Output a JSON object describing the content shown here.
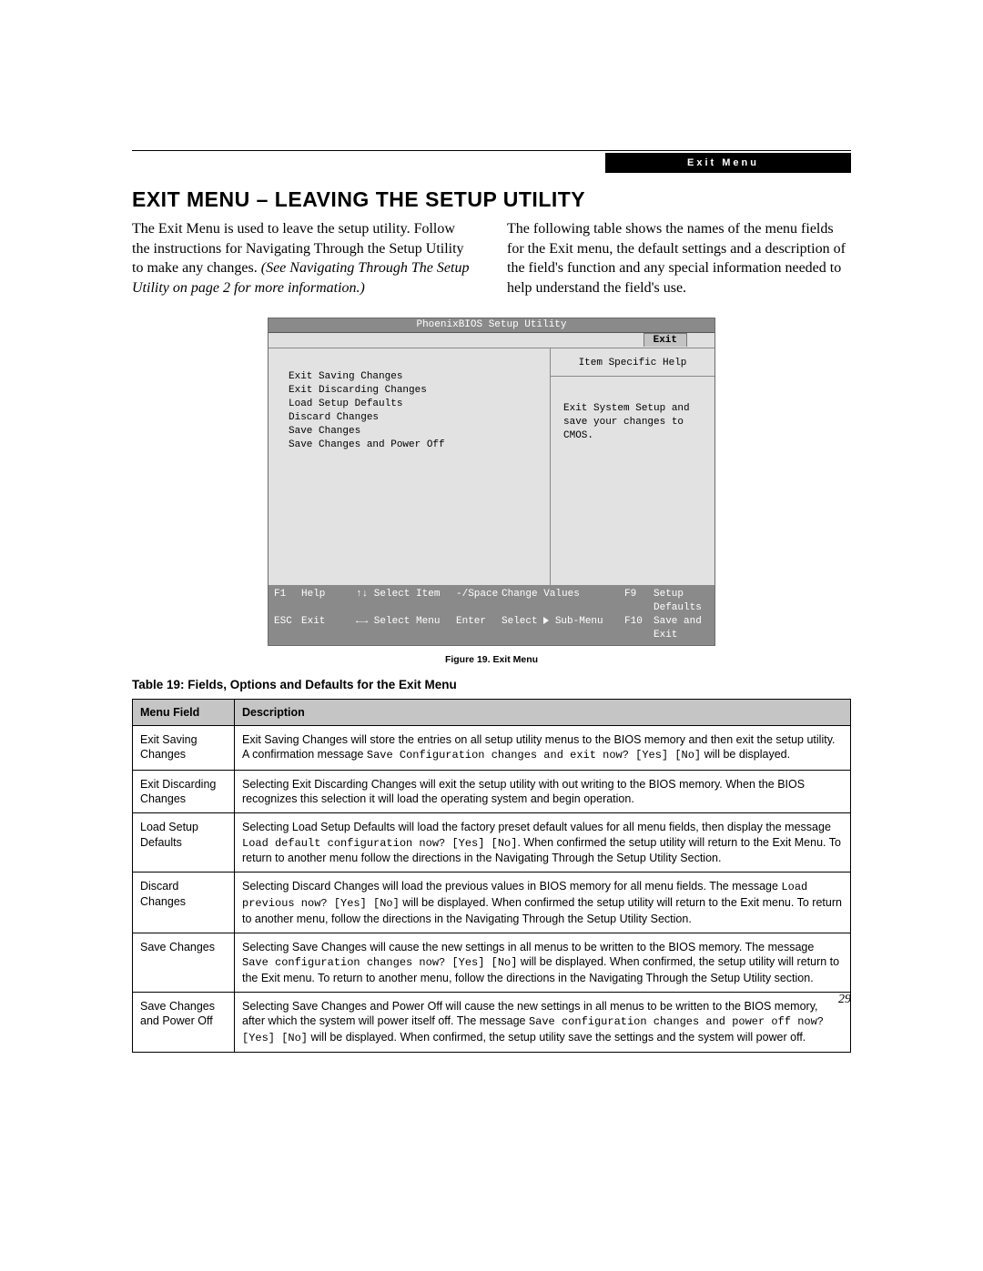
{
  "headerBadge": "Exit Menu",
  "pageTitle": "EXIT MENU – LEAVING THE SETUP UTILITY",
  "introLeft": {
    "span1": "The Exit Menu is used to leave the setup utility. Follow the instructions for Navigating Through the Setup Utility to make any changes. ",
    "italic": "(See Navigating Through The Setup Utility on page 2 for more information.)"
  },
  "introRight": "The following table shows the names of the menu fields for the Exit menu, the default settings and a description of the field's function and any special information needed to help understand the field's use.",
  "bios": {
    "title": "PhoenixBIOS Setup Utility",
    "tab": "Exit",
    "menuItems": [
      "Exit Saving Changes",
      "Exit Discarding Changes",
      "Load Setup Defaults",
      "Discard Changes",
      "Save Changes",
      "Save Changes and Power Off"
    ],
    "helpHeader": "Item Specific Help",
    "helpBody": "Exit System Setup and save your changes to CMOS.",
    "footer": {
      "row1": {
        "k1": "F1",
        "l1": "Help",
        "k2": "↑↓ Select Item",
        "k3": "-/Space",
        "l3": "Change Values",
        "k4": "F9",
        "l4": "Setup Defaults"
      },
      "row2": {
        "k1": "ESC",
        "l1": "Exit",
        "k2": "←→ Select Menu",
        "k3": "Enter",
        "l3": "Select ▶ Sub-Menu",
        "k4": "F10",
        "l4": "Save and Exit"
      }
    }
  },
  "figureCaption": "Figure 19.  Exit Menu",
  "tableTitle": "Table 19: Fields, Options and Defaults for the Exit Menu",
  "tableHeaders": {
    "field": "Menu Field",
    "desc": "Description"
  },
  "tableRows": [
    {
      "field": "Exit Saving Changes",
      "parts": [
        [
          "t",
          "Exit Saving Changes will store the entries on all setup utility menus to the BIOS memory and then exit the setup utility. A confirmation message "
        ],
        [
          "m",
          "Save Configuration changes and exit now? [Yes] [No]"
        ],
        [
          "t",
          " will be displayed."
        ]
      ]
    },
    {
      "field": "Exit Discarding Changes",
      "parts": [
        [
          "t",
          "Selecting Exit Discarding Changes will exit the setup utility with out writing to the BIOS memory. When the BIOS recognizes this selection it will load the operating system and begin operation."
        ]
      ]
    },
    {
      "field": "Load Setup Defaults",
      "parts": [
        [
          "t",
          "Selecting Load Setup Defaults will load the factory preset default values for all menu fields, then display the message "
        ],
        [
          "m",
          "Load default configuration now? [Yes] [No]"
        ],
        [
          "t",
          ". When confirmed the setup utility will return to the Exit Menu. To return to another menu follow the directions in the Navigating Through the Setup Utility Section."
        ]
      ]
    },
    {
      "field": "Discard Changes",
      "parts": [
        [
          "t",
          "Selecting Discard Changes will load the previous values in BIOS memory for all menu fields. The message "
        ],
        [
          "m",
          "Load previous now? [Yes] [No]"
        ],
        [
          "t",
          " will be displayed. When confirmed the setup utility will return to the Exit menu. To return to another menu, follow the directions in the Navigating Through the Setup Utility Section."
        ]
      ]
    },
    {
      "field": "Save Changes",
      "parts": [
        [
          "t",
          "Selecting Save Changes will cause the new settings in all menus to be written to the BIOS memory. The message "
        ],
        [
          "m",
          "Save configuration changes now? [Yes] [No]"
        ],
        [
          "t",
          " will be displayed. When confirmed, the setup utility will return to the Exit menu. To return to another menu, follow the directions in the Navigating Through the Setup Utility section."
        ]
      ]
    },
    {
      "field": "Save Changes and Power Off",
      "parts": [
        [
          "t",
          "Selecting Save Changes and Power Off will cause the new settings in all menus to be written to the BIOS memory, after which the system will power itself off. The message "
        ],
        [
          "m",
          "Save configuration changes and power off now? [Yes] [No]"
        ],
        [
          "t",
          " will be displayed. When confirmed, the setup utility save the settings and the system will power off."
        ]
      ]
    }
  ],
  "pageNumber": "29"
}
